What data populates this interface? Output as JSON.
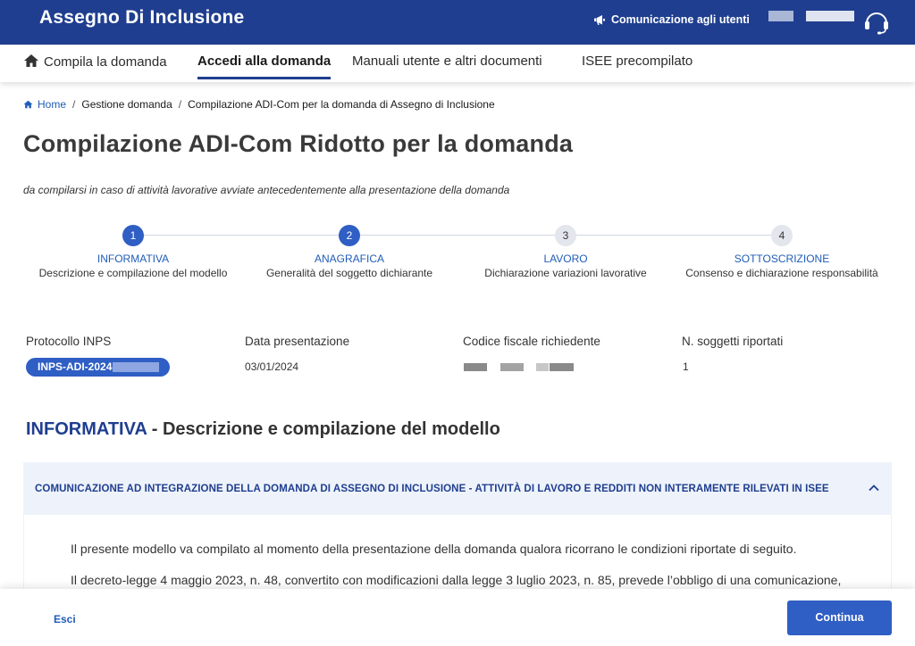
{
  "header": {
    "app_title": "Assegno Di Inclusione",
    "communication_label": "Comunicazione agli utenti",
    "icons": [
      "megaphone-icon",
      "headset-icon"
    ]
  },
  "nav": {
    "items": [
      {
        "label": "Compila la domanda",
        "icon": "home-icon",
        "active": false
      },
      {
        "label": "Accedi alla domanda",
        "active": true
      },
      {
        "label": "Manuali utente e altri documenti",
        "active": false
      },
      {
        "label": "ISEE precompilato",
        "active": false
      }
    ]
  },
  "breadcrumb": {
    "items": [
      "Home",
      "Gestione domanda",
      "Compilazione ADI-Com per la domanda di Assegno di Inclusione"
    ]
  },
  "page": {
    "title": "Compilazione ADI-Com Ridotto per la domanda",
    "subtitle": "da compilarsi in caso di attività lavorative avviate antecedentemente alla presentazione della domanda"
  },
  "stepper": {
    "steps": [
      {
        "number": "1",
        "title": "INFORMATIVA",
        "description": "Descrizione e compilazione del modello",
        "active": true
      },
      {
        "number": "2",
        "title": "ANAGRAFICA",
        "description": "Generalità del soggetto dichiarante",
        "active": true
      },
      {
        "number": "3",
        "title": "LAVORO",
        "description": "Dichiarazione variazioni lavorative",
        "active": false
      },
      {
        "number": "4",
        "title": "SOTTOSCRIZIONE",
        "description": "Consenso e dichiarazione responsabilità",
        "active": false
      }
    ]
  },
  "summary": {
    "protocol_label": "Protocollo INPS",
    "protocol_value": "INPS-ADI-2024-",
    "date_label": "Data presentazione",
    "date_value": "03/01/2024",
    "fiscal_code_label": "Codice fiscale richiedente",
    "subjects_label": "N. soggetti riportati",
    "subjects_value": "1"
  },
  "section": {
    "heading_accent": "INFORMATIVA",
    "heading_rest": " - Descrizione e compilazione del modello"
  },
  "accordion": {
    "title": "COMUNICAZIONE AD INTEGRAZIONE DELLA DOMANDA DI ASSEGNO DI INCLUSIONE - ATTIVITÀ DI LAVORO E REDDITI NON INTERAMENTE RILEVATI IN ISEE",
    "paragraphs": [
      "Il presente modello va compilato al momento della presentazione della domanda qualora ricorrano le condizioni riportate di seguito.",
      "Il decreto-legge 4 maggio 2023, n. 48, convertito con modificazioni dalla legge 3 luglio 2023, n. 85, prevede l’obbligo di una comunicazione,"
    ]
  },
  "footer": {
    "exit_label": "Esci",
    "continue_label": "Continua"
  },
  "colors": {
    "brand_blue": "#1f3e8f",
    "accent_blue": "#2f5ec4",
    "link_blue": "#1f5cb8",
    "accordion_bg": "#eef3fb"
  }
}
